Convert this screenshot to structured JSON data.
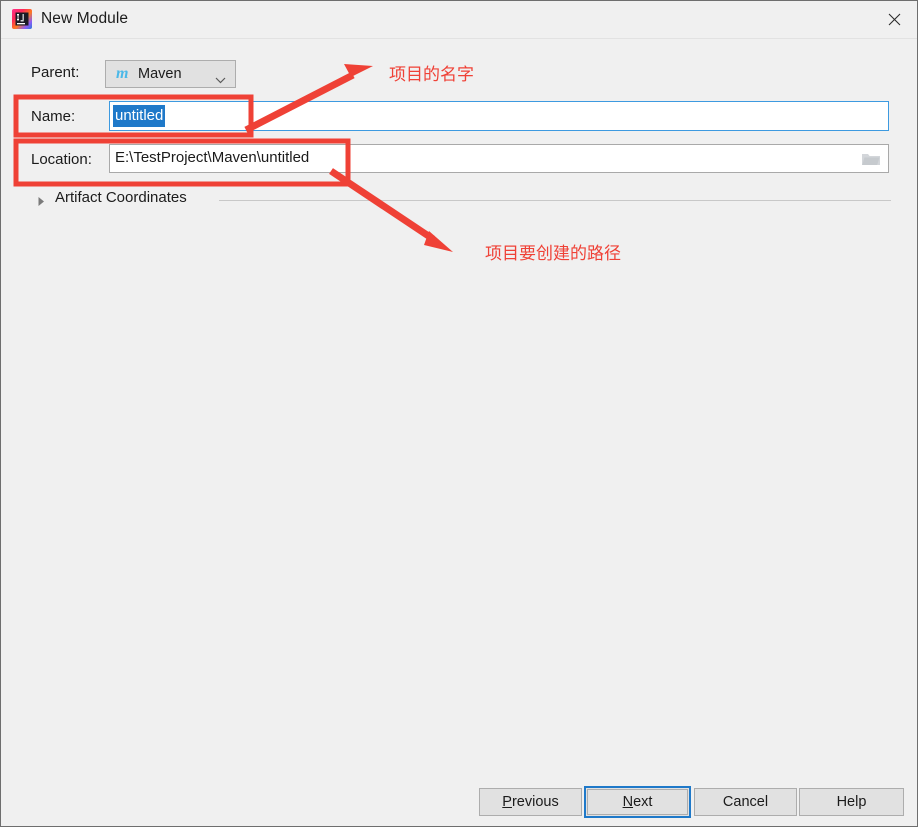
{
  "window": {
    "title": "New Module",
    "app_icon": "intellij-idea-icon",
    "close_icon": "close-icon"
  },
  "form": {
    "parent": {
      "label": "Parent:",
      "value": "Maven",
      "logo_glyph": "m",
      "logo_color": "#4bb8e8",
      "chevron_icon": "chevron-down-icon"
    },
    "name": {
      "label": "Name:",
      "value": "untitled",
      "placeholder": "",
      "selected": true,
      "selection_color": "#1f79c9",
      "focus_border_color": "#3d9ae0"
    },
    "location": {
      "label": "Location:",
      "value": "E:\\TestProject\\Maven\\untitled",
      "placeholder": "",
      "browse_icon": "folder-open-icon"
    },
    "artifact_coordinates": {
      "label": "Artifact Coordinates",
      "expanded": false,
      "triangle_icon": "triangle-right-icon"
    }
  },
  "buttons": {
    "previous": {
      "label": "Previous",
      "mnemonic": "P"
    },
    "next": {
      "label": "Next",
      "mnemonic": "N",
      "focused": true
    },
    "cancel": {
      "label": "Cancel"
    },
    "help": {
      "label": "Help"
    }
  },
  "annotations": {
    "color": "#ef4136",
    "name_note": "项目的名字",
    "location_note": "项目要创建的路径"
  }
}
